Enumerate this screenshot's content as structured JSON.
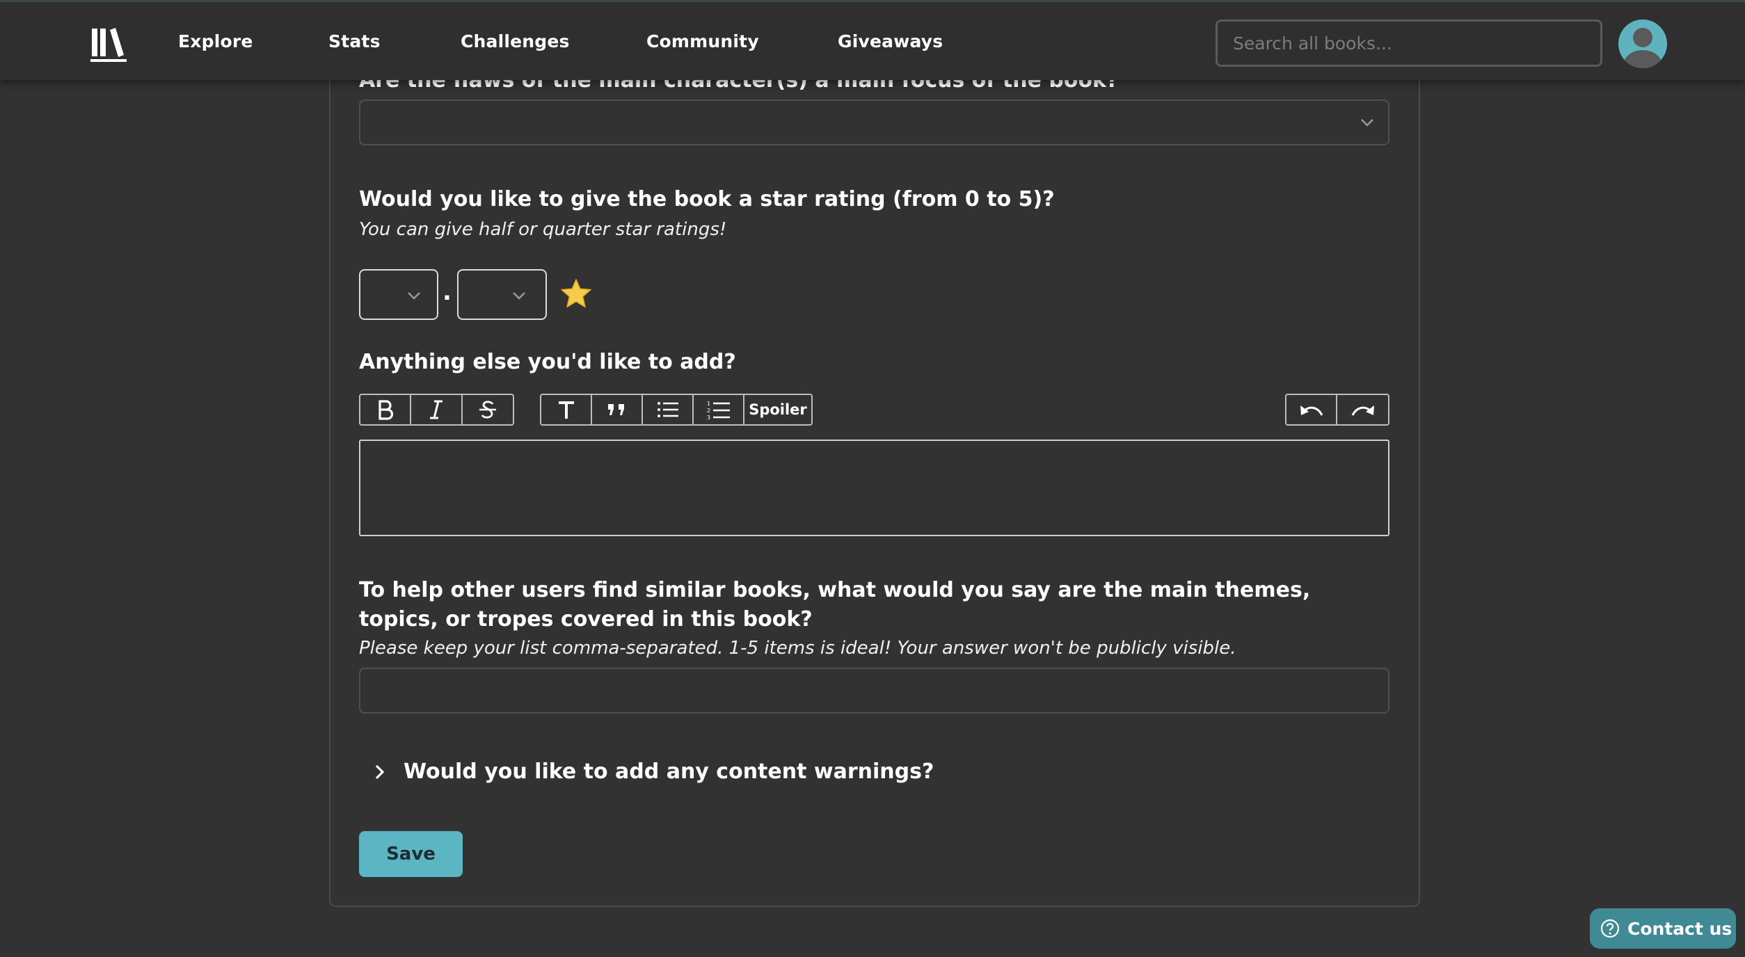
{
  "nav": {
    "items": [
      "Explore",
      "Stats",
      "Challenges",
      "Community",
      "Giveaways"
    ],
    "search_placeholder": "Search all books..."
  },
  "form": {
    "cut_off_question": "Are the flaws of the main character(s) a main focus of the book?",
    "rating": {
      "question": "Would you like to give the book a star rating (from 0 to 5)?",
      "hint": "You can give half or quarter star ratings!",
      "separator": "."
    },
    "additional": {
      "question": "Anything else you'd like to add?",
      "toolbar": {
        "format_buttons": [
          "bold-icon",
          "italic-icon",
          "strikethrough-icon"
        ],
        "block_buttons": [
          "heading-icon",
          "quote-icon",
          "bullet-list-icon",
          "numbered-list-icon"
        ],
        "spoiler_label": "Spoiler",
        "history_buttons": [
          "undo-icon",
          "redo-icon"
        ]
      }
    },
    "themes": {
      "question": "To help other users find similar books, what would you say are the main themes, topics, or tropes covered in this book?",
      "hint": "Please keep your list comma-separated. 1-5 items is ideal! Your answer won't be publicly visible."
    },
    "content_warnings": {
      "label": "Would you like to add any content warnings?"
    },
    "save_label": "Save"
  },
  "contact_label": "Contact us",
  "colors": {
    "background": "#323232",
    "accent": "#5bb5c2",
    "star": "#f5cd4a"
  }
}
